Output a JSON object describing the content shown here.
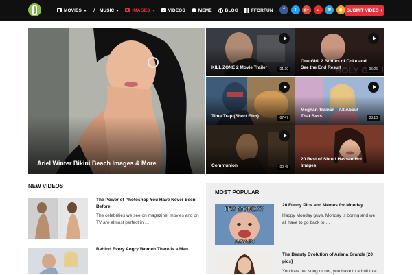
{
  "header": {
    "logo_name": "leaf-logo",
    "nav": [
      {
        "icon": "film-icon",
        "label": "MOVIES",
        "has_caret": true,
        "active": false
      },
      {
        "icon": "music-icon",
        "label": "MUSIC",
        "has_caret": true,
        "active": false
      },
      {
        "icon": "camera-icon",
        "label": "IMAGES",
        "has_caret": true,
        "active": true
      },
      {
        "icon": "video-icon",
        "label": "VIDEOS",
        "has_caret": false,
        "active": false
      },
      {
        "icon": "skull-icon",
        "label": "MEME",
        "has_caret": false,
        "active": false
      },
      {
        "icon": "globe-icon",
        "label": "BLOG",
        "has_caret": false,
        "active": false
      },
      {
        "icon": "grid-icon",
        "label": "FFORFUN",
        "has_caret": false,
        "active": false
      }
    ],
    "socials": [
      {
        "name": "facebook-icon",
        "glyph": "f",
        "color": "#3b5998"
      },
      {
        "name": "twitter-icon",
        "glyph": "t",
        "color": "#1da1f2"
      },
      {
        "name": "google-plus-icon",
        "glyph": "g+",
        "color": "#dd4b39"
      },
      {
        "name": "youtube-icon",
        "glyph": "▶",
        "color": "#e52d27"
      },
      {
        "name": "email-icon",
        "glyph": "✉",
        "color": "#2ca7e0"
      },
      {
        "name": "rss-icon",
        "glyph": "◉",
        "color": "#f5a623"
      }
    ],
    "submit_label": "SUBMIT VIDEO +"
  },
  "hero": {
    "main_title": "Ariel Winter Bikini Beach Images & More",
    "tiles": [
      {
        "title": "KILL ZONE 2 Movie Trailer",
        "duration": "01:30",
        "play": true
      },
      {
        "title": "One Girl, 2 Bottles of Coke and See the End Result",
        "duration": "05:26",
        "play": true
      },
      {
        "title": "Time Trap (Short Film)",
        "duration": "07:47",
        "play": true
      },
      {
        "title": "Meghan Trainor – All About That Bass",
        "duration": "03:10",
        "play": true
      },
      {
        "title": "Communion",
        "duration": "00:45",
        "play": true
      },
      {
        "title": "20 Best of Shruti Hassan Hot Images",
        "duration": "",
        "play": false
      }
    ]
  },
  "new_videos": {
    "heading": "NEW VIDEOS",
    "items": [
      {
        "title": "The Power of Photoshop You Have Never Seen Before",
        "text": "The celebrities we see on magazine, movies and on TV are almost perfect in …"
      },
      {
        "title": "Behind Every Angry Women There is a Man",
        "text": ""
      }
    ]
  },
  "most_popular": {
    "heading": "MOST POPULAR",
    "items": [
      {
        "title": "20 Funny Pics and Memes for Monday",
        "text": "Happy Monday guys. Monday is boring and we all have to go back to …",
        "thumb_text_top": "IT'S MONDAY",
        "thumb_text_bottom": "AGAIN"
      },
      {
        "title": "The Beauty Evolution of Ariana Grande [20 pics]",
        "text": "You love her song or not, you have to admit that"
      }
    ]
  }
}
